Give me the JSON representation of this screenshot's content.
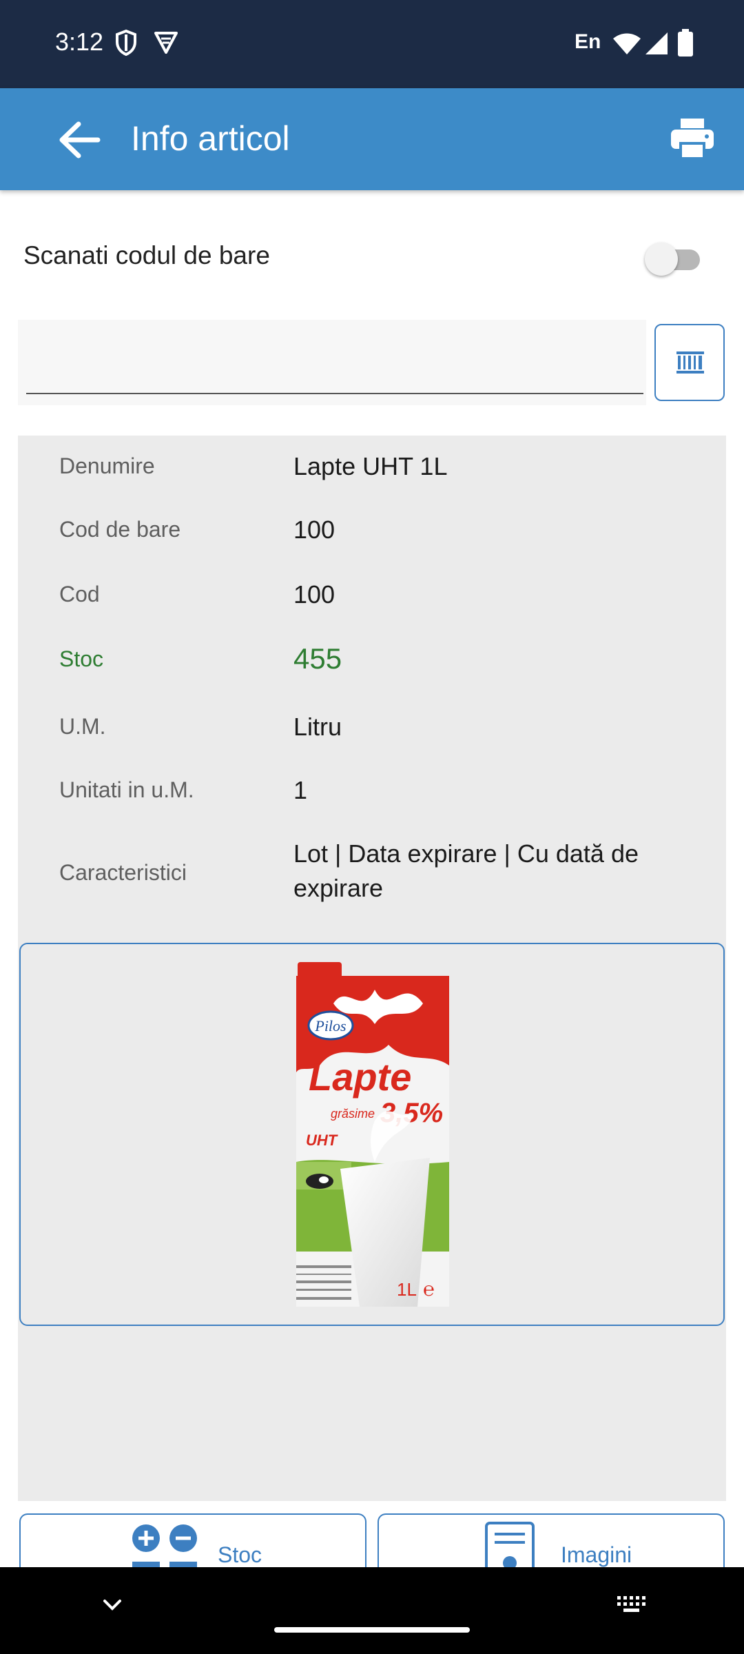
{
  "status_bar": {
    "time": "3:12",
    "language": "En",
    "icons": [
      "shield-icon",
      "vpn-icon",
      "wifi-icon",
      "signal-icon",
      "battery-icon"
    ]
  },
  "app_bar": {
    "title": "Info articol",
    "icons": [
      "arrow-back-icon",
      "print-icon"
    ],
    "background_color": "#3d8bc8"
  },
  "scan": {
    "label": "Scanati codul de bare",
    "toggle_on": false,
    "input_value": ""
  },
  "details": [
    {
      "label": "Denumire",
      "value": "Lapte UHT 1L"
    },
    {
      "label": "Cod de bare",
      "value": "100"
    },
    {
      "label": "Cod",
      "value": "100"
    },
    {
      "label": "Stoc",
      "value": "455"
    },
    {
      "label": "U.M.",
      "value": "Litru"
    },
    {
      "label": "Unitati in u.M.",
      "value": "1"
    },
    {
      "label": "Caracteristici",
      "value_line1": "Lot | Data expirare | Cu dată de",
      "value_line2": "expirare"
    }
  ],
  "stock_color": "#2e7d32",
  "product_image": {
    "brand": "Pilos",
    "name": "Lapte",
    "fat_label": "grăsime",
    "fat": "3,5%",
    "type": "UHT",
    "volume": "1L"
  },
  "bottom_buttons": {
    "stock_label": "Stoc",
    "images_label": "Imagini"
  },
  "nav_bar": {
    "icons": [
      "chevron-down-icon",
      "keyboard-icon"
    ]
  }
}
